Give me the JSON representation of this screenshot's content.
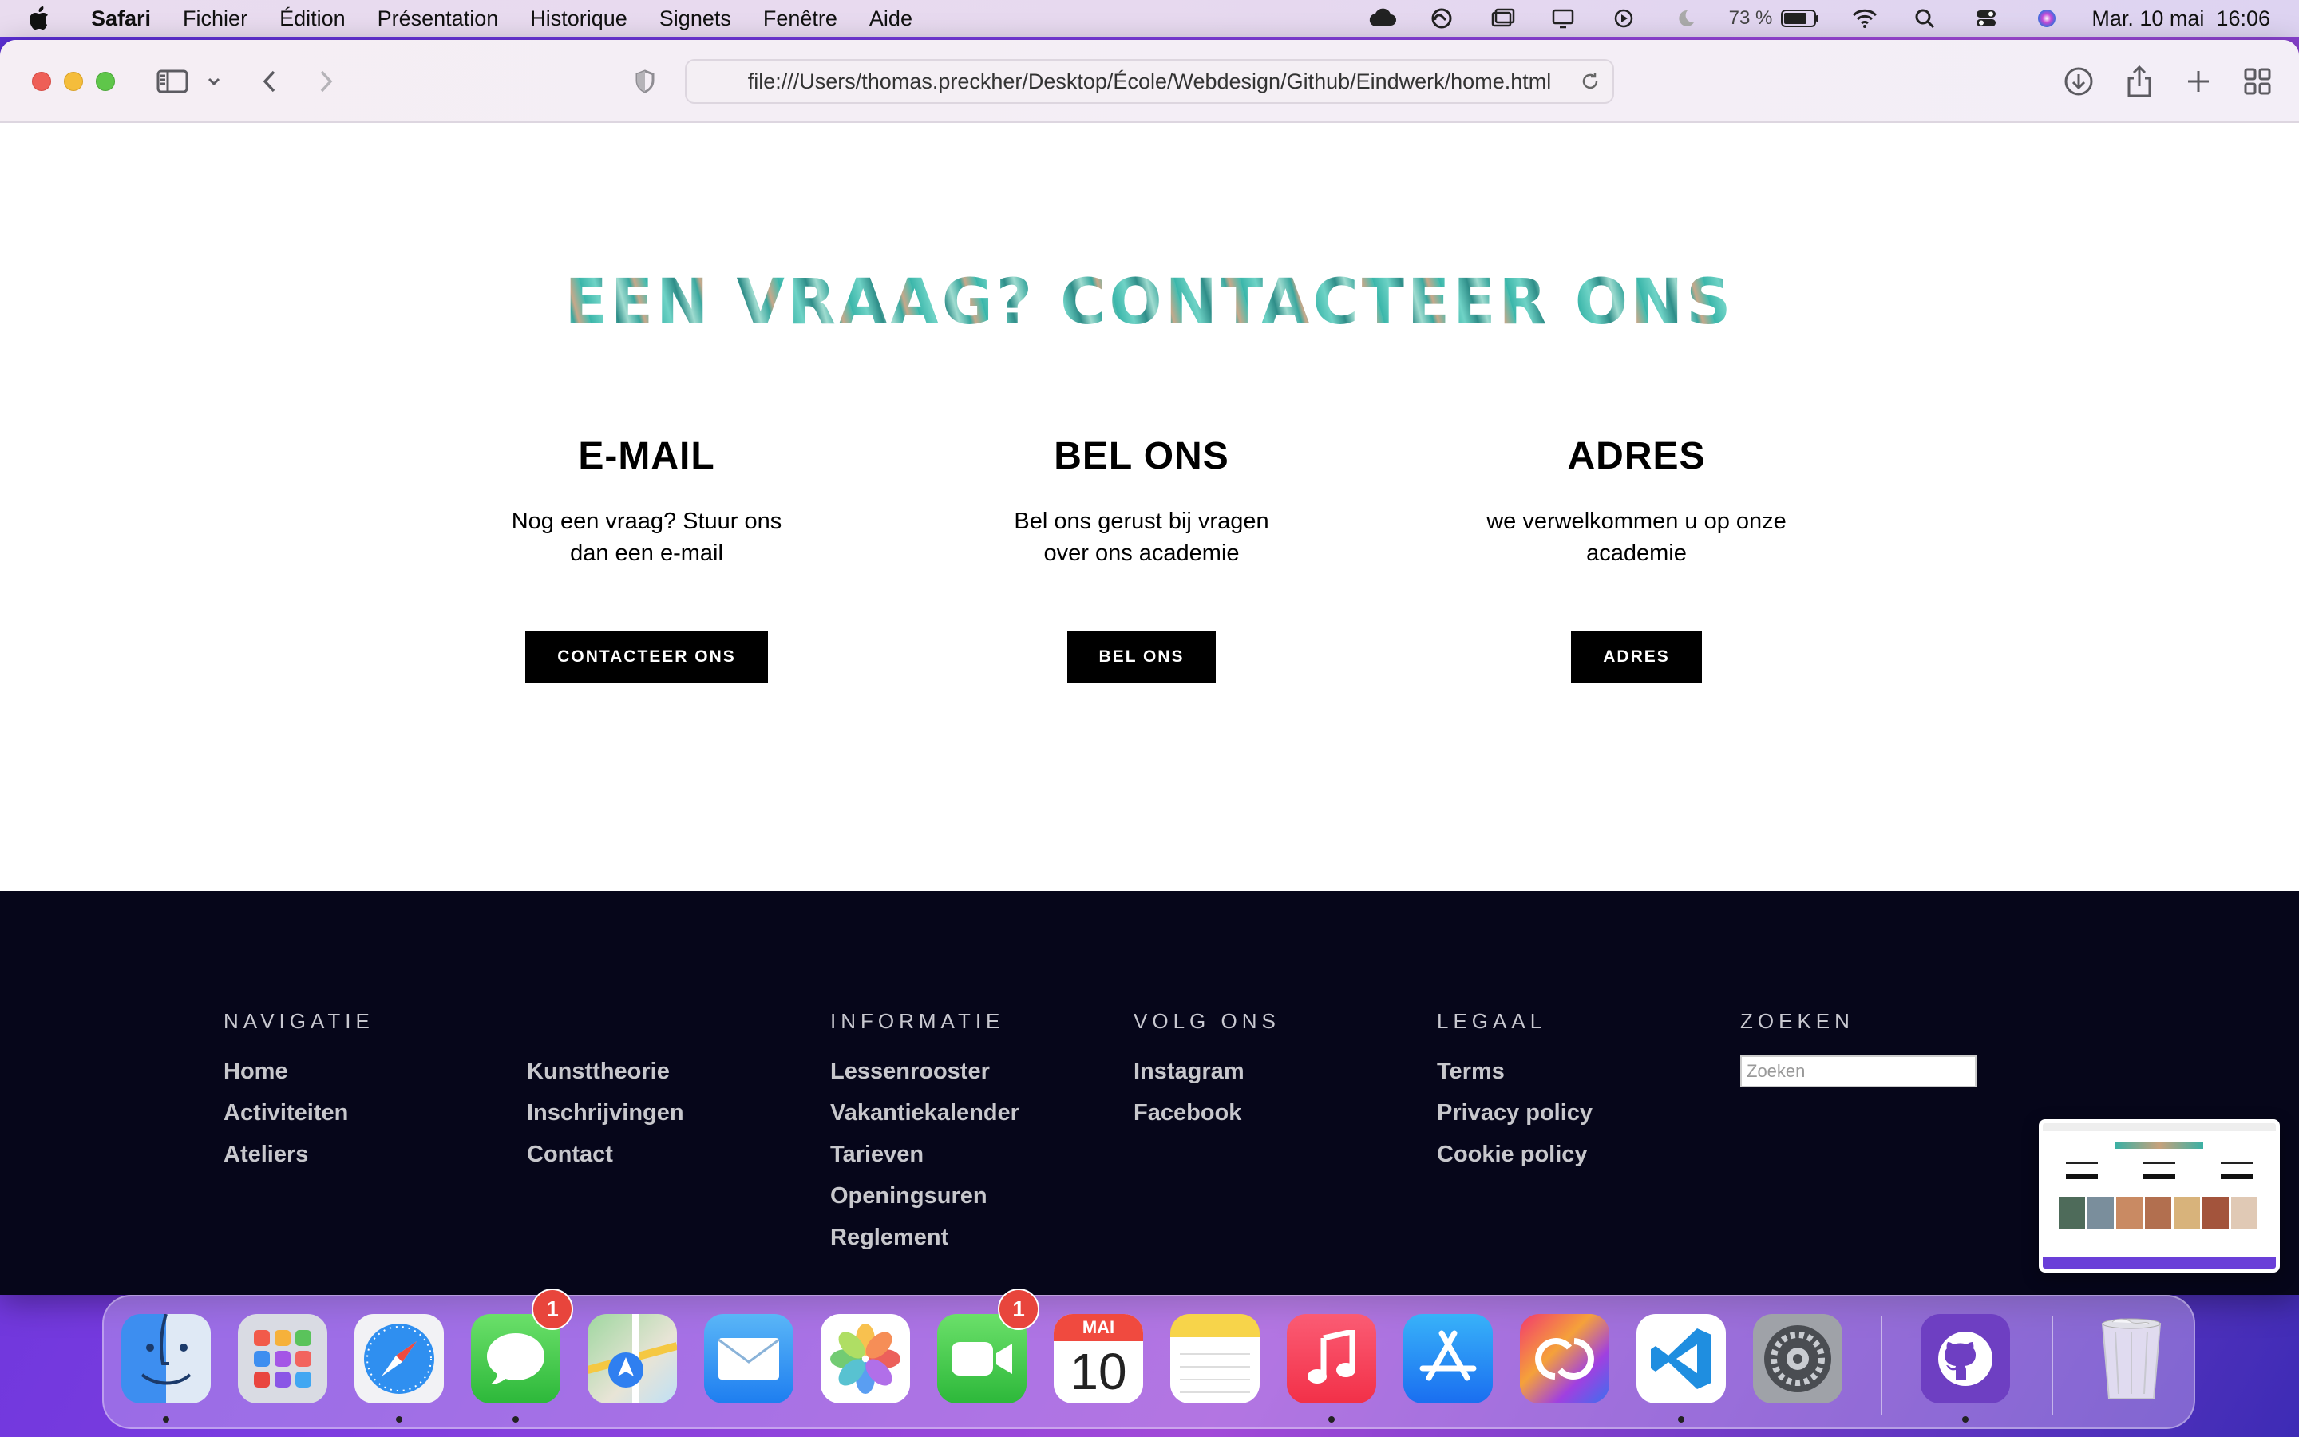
{
  "menubar": {
    "app_name": "Safari",
    "menus": [
      "Fichier",
      "Édition",
      "Présentation",
      "Historique",
      "Signets",
      "Fenêtre",
      "Aide"
    ],
    "battery": "73 %",
    "datetime": "Mar. 10 mai  16:06"
  },
  "browser": {
    "url": "file:///Users/thomas.preckher/Desktop/École/Webdesign/Github/Eindwerk/home.html"
  },
  "page": {
    "title": "EEN VRAAG? CONTACTEER ONS",
    "columns": [
      {
        "heading": "E-MAIL",
        "text": "Nog een vraag? Stuur ons dan een e-mail",
        "button": "CONTACTEER ONS"
      },
      {
        "heading": "BEL ONS",
        "text": "Bel ons gerust bij vragen over ons academie",
        "button": "BEL ONS"
      },
      {
        "heading": "ADRES",
        "text": "we verwelkommen u op onze academie",
        "button": "ADRES"
      }
    ]
  },
  "footer": {
    "navigatie": {
      "heading": "NAVIGATIE",
      "links_a": [
        "Home",
        "Activiteiten",
        "Ateliers"
      ],
      "links_b": [
        "Kunsttheorie",
        "Inschrijvingen",
        "Contact"
      ]
    },
    "informatie": {
      "heading": "INFORMATIE",
      "links": [
        "Lessenrooster",
        "Vakantiekalender",
        "Tarieven",
        "Openingsuren",
        "Reglement"
      ]
    },
    "volg": {
      "heading": "VOLG ONS",
      "links": [
        "Instagram",
        "Facebook"
      ]
    },
    "legaal": {
      "heading": "LEGAAL",
      "links": [
        "Terms",
        "Privacy policy",
        "Cookie policy"
      ]
    },
    "zoeken": {
      "heading": "ZOEKEN",
      "placeholder": "Zoeken"
    }
  },
  "dock": {
    "apps": [
      "finder-icon",
      "launchpad-icon",
      "safari-icon",
      "messages-icon",
      "maps-icon",
      "mail-icon",
      "photos-icon",
      "facetime-icon",
      "calendar-icon",
      "notes-icon",
      "music-icon",
      "app-store-icon",
      "creative-cloud-icon",
      "vscode-icon",
      "system-preferences-icon",
      "github-desktop-icon",
      "trash-icon"
    ],
    "messages_badge": "1",
    "facetime_badge": "1",
    "calendar_month": "MAI",
    "calendar_day": "10"
  }
}
